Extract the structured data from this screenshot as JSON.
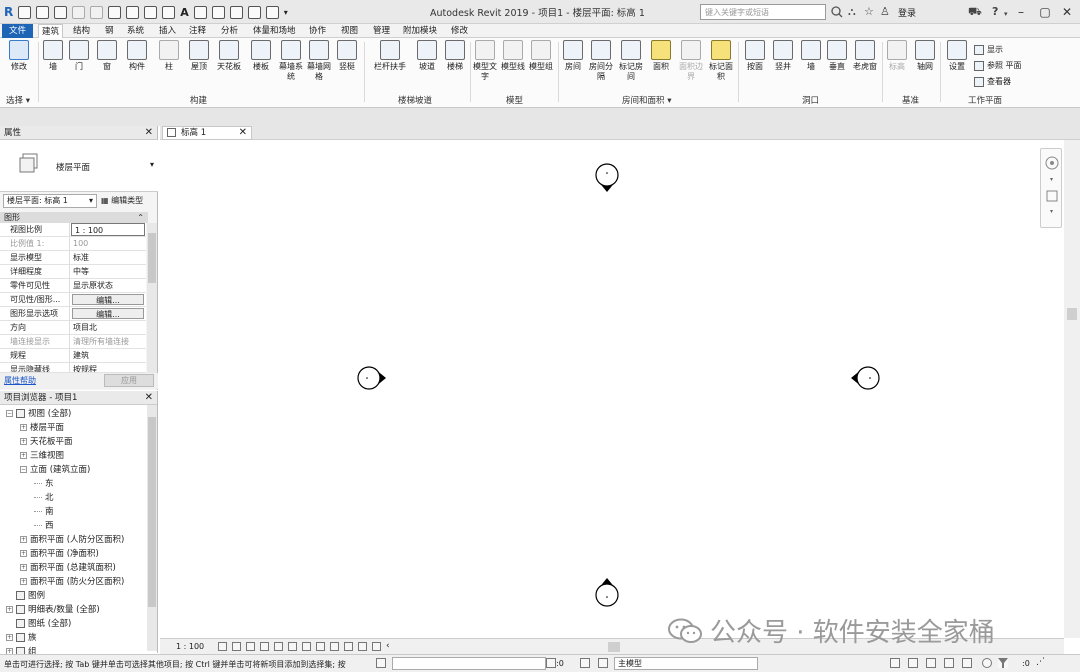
{
  "app": {
    "title": "Autodesk Revit 2019 - 项目1 - 楼层平面: 标高 1",
    "search_placeholder": "键入关键字或短语",
    "login": "登录",
    "help": "?"
  },
  "menu": {
    "tabs": [
      "文件",
      "建筑",
      "结构",
      "钢",
      "系统",
      "插入",
      "注释",
      "分析",
      "体量和场地",
      "协作",
      "视图",
      "管理",
      "附加模块",
      "修改"
    ],
    "active": "建筑"
  },
  "ribbon": {
    "select": {
      "modify": "修改",
      "group": "选择"
    },
    "build": {
      "buttons": [
        "墙",
        "门",
        "窗",
        "构件",
        "柱",
        "屋顶",
        "天花板",
        "楼板",
        "幕墙系统",
        "幕墙网格",
        "竖梃"
      ],
      "label": "构建"
    },
    "stairs": {
      "buttons": [
        "栏杆扶手",
        "坡道",
        "楼梯"
      ],
      "label": "楼梯坡道"
    },
    "model": {
      "buttons": [
        "模型文字",
        "模型线",
        "模型组"
      ],
      "label": "模型"
    },
    "room": {
      "buttons": [
        "房间",
        "房间分隔",
        "标记房间",
        "面积",
        "面积边界",
        "标记面积"
      ],
      "label": "房间和面积"
    },
    "opening": {
      "buttons": [
        "按面",
        "竖井",
        "墙",
        "垂直",
        "老虎窗"
      ],
      "label": "洞口"
    },
    "datum": {
      "buttons": [
        "标高",
        "轴网"
      ],
      "label": "基准"
    },
    "workplane": {
      "set": "设置",
      "small": [
        "显示",
        "参照 平面",
        "查看器"
      ],
      "label": "工作平面"
    }
  },
  "properties": {
    "header": "属性",
    "type_name": "楼层平面",
    "filter": "楼层平面: 标高 1",
    "edit_type": "编辑类型",
    "group": "图形",
    "rows": [
      {
        "k": "视图比例",
        "v": "1 : 100"
      },
      {
        "k": "比例值 1:",
        "v": "100"
      },
      {
        "k": "显示模型",
        "v": "标准"
      },
      {
        "k": "详细程度",
        "v": "中等"
      },
      {
        "k": "零件可见性",
        "v": "显示原状态"
      },
      {
        "k": "可见性/图形...",
        "v": "编辑..."
      },
      {
        "k": "图形显示选项",
        "v": "编辑..."
      },
      {
        "k": "方向",
        "v": "项目北"
      },
      {
        "k": "墙连接显示",
        "v": "清理所有墙连接"
      },
      {
        "k": "规程",
        "v": "建筑"
      },
      {
        "k": "显示隐藏线",
        "v": "按规程"
      }
    ],
    "help": "属性帮助",
    "apply": "应用"
  },
  "browser": {
    "header": "项目浏览器 - 项目1",
    "items": [
      {
        "label": "视图 (全部)",
        "level": 0,
        "exp": "−"
      },
      {
        "label": "楼层平面",
        "level": 1,
        "exp": "+"
      },
      {
        "label": "天花板平面",
        "level": 1,
        "exp": "+"
      },
      {
        "label": "三维视图",
        "level": 1,
        "exp": "+"
      },
      {
        "label": "立面 (建筑立面)",
        "level": 1,
        "exp": "−"
      },
      {
        "label": "东",
        "level": 2,
        "exp": ""
      },
      {
        "label": "北",
        "level": 2,
        "exp": ""
      },
      {
        "label": "南",
        "level": 2,
        "exp": ""
      },
      {
        "label": "西",
        "level": 2,
        "exp": ""
      },
      {
        "label": "面积平面 (人防分区面积)",
        "level": 1,
        "exp": "+"
      },
      {
        "label": "面积平面 (净面积)",
        "level": 1,
        "exp": "+"
      },
      {
        "label": "面积平面 (总建筑面积)",
        "level": 1,
        "exp": "+"
      },
      {
        "label": "面积平面 (防火分区面积)",
        "level": 1,
        "exp": "+"
      },
      {
        "label": "图例",
        "level": 0,
        "exp": ""
      },
      {
        "label": "明细表/数量 (全部)",
        "level": 0,
        "exp": "+"
      },
      {
        "label": "图纸 (全部)",
        "level": 0,
        "exp": ""
      },
      {
        "label": "族",
        "level": 0,
        "exp": "+"
      },
      {
        "label": "组",
        "level": 0,
        "exp": "+"
      }
    ]
  },
  "view": {
    "tab": "标高 1",
    "scale": "1 : 100"
  },
  "status": {
    "text": "单击可进行选择; 按 Tab 键并单击可选择其他项目; 按 Ctrl 键并单击可将新项目添加到选择集; 按",
    "coord": ":0",
    "model": "主模型",
    "filter_count": ":0"
  },
  "watermark": "公众号 · 软件安装全家桶"
}
